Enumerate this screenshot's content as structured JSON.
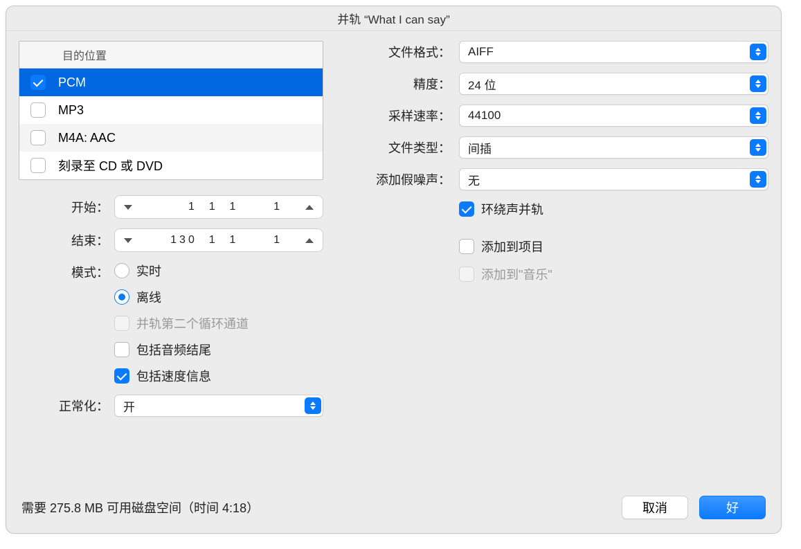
{
  "title": "并轨 “What I can say”",
  "destinations": {
    "header": "目的位置",
    "items": [
      {
        "label": "PCM",
        "checked": true,
        "selected": true
      },
      {
        "label": "MP3",
        "checked": false,
        "selected": false
      },
      {
        "label": "M4A: AAC",
        "checked": false,
        "selected": false
      },
      {
        "label": "刻录至 CD 或 DVD",
        "checked": false,
        "selected": false
      }
    ]
  },
  "range": {
    "start_label": "开始：",
    "start_value": "1  1  1      1",
    "end_label": "结束：",
    "end_value": "130  1  1      1"
  },
  "mode": {
    "label": "模式：",
    "options": [
      {
        "label": "实时",
        "selected": false
      },
      {
        "label": "离线",
        "selected": true
      }
    ],
    "second_pass": {
      "label": "并轨第二个循环通道",
      "checked": false,
      "disabled": true
    },
    "include_tail": {
      "label": "包括音频结尾",
      "checked": false
    },
    "include_tempo": {
      "label": "包括速度信息",
      "checked": true
    }
  },
  "normalize": {
    "label": "正常化：",
    "value": "开"
  },
  "format": {
    "file_format": {
      "label": "文件格式：",
      "value": "AIFF"
    },
    "resolution": {
      "label": "精度：",
      "value": "24 位"
    },
    "sample_rate": {
      "label": "采样速率：",
      "value": "44100"
    },
    "file_type": {
      "label": "文件类型：",
      "value": "间插"
    },
    "dither": {
      "label": "添加假噪声：",
      "value": "无"
    }
  },
  "options": {
    "surround": {
      "label": "环绕声并轨",
      "checked": true
    },
    "add_project": {
      "label": "添加到项目",
      "checked": false
    },
    "add_music": {
      "label": "添加到\"音乐\"",
      "checked": false,
      "disabled": true
    }
  },
  "footer": {
    "status": "需要 275.8 MB 可用磁盘空间（时间 4:18）",
    "cancel": "取消",
    "ok": "好"
  }
}
